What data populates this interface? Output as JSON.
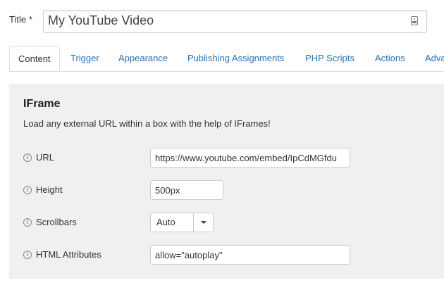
{
  "title": {
    "label": "Title *",
    "value": "My YouTube Video"
  },
  "tabs": [
    {
      "label": "Content"
    },
    {
      "label": "Trigger"
    },
    {
      "label": "Appearance"
    },
    {
      "label": "Publishing Assignments"
    },
    {
      "label": "PHP Scripts"
    },
    {
      "label": "Actions"
    },
    {
      "label": "Adva"
    }
  ],
  "panel": {
    "heading": "IFrame",
    "description": "Load any external URL within a box with the help of IFrames!",
    "fields": {
      "url": {
        "label": "URL",
        "value": "https://www.youtube.com/embed/IpCdMGfdu"
      },
      "height": {
        "label": "Height",
        "value": "500px"
      },
      "scrollbars": {
        "label": "Scrollbars",
        "value": "Auto"
      },
      "html_attributes": {
        "label": "HTML Attributes",
        "value": "allow=\"autoplay\""
      }
    }
  }
}
